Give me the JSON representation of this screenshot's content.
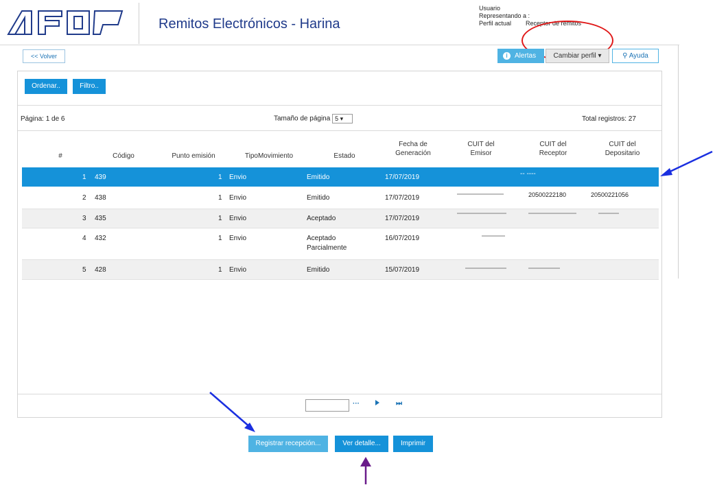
{
  "header": {
    "app_title": "Remitos Electrónicos - Harina",
    "usuario_label": "Usuario",
    "representando_label": "Representando a :",
    "perfil_label": "Perfil actual",
    "perfil_value": "Receptor de remitos"
  },
  "toolbar": {
    "volver": "<< Volver",
    "alertas": "Alertas",
    "cambiar_perfil": "Cambiar perfil ▾",
    "ayuda": "Ayuda"
  },
  "actions": {
    "ordenar": "Ordenar..",
    "filtro": "Filtro.."
  },
  "paging": {
    "pagina": "Página: 1 de 6",
    "tamanio_label": "Tamaño de página",
    "tamanio_value": "5 ▾",
    "total": "Total registros: 27"
  },
  "table": {
    "columns": [
      "#",
      "Código",
      "Punto emisión",
      "TipoMovimiento",
      "Estado",
      "Fecha de Generación",
      "CUIT del Emisor",
      "CUIT del Receptor",
      "CUIT del Depositario"
    ],
    "rows": [
      {
        "n": "1",
        "codigo": "439",
        "punto": "1",
        "tipo": "Envio",
        "estado": "Emitido",
        "fecha": "17/07/2019",
        "emisor": "",
        "receptor": "-- ----",
        "depositario": ""
      },
      {
        "n": "2",
        "codigo": "438",
        "punto": "1",
        "tipo": "Envio",
        "estado": "Emitido",
        "fecha": "17/07/2019",
        "emisor": "",
        "receptor": "20500222180",
        "depositario": "20500221056"
      },
      {
        "n": "3",
        "codigo": "435",
        "punto": "1",
        "tipo": "Envio",
        "estado": "Aceptado",
        "fecha": "17/07/2019",
        "emisor": "",
        "receptor": "",
        "depositario": ""
      },
      {
        "n": "4",
        "codigo": "432",
        "punto": "1",
        "tipo": "Envio",
        "estado": "Aceptado Parcialmente",
        "fecha": "16/07/2019",
        "emisor": "",
        "receptor": "",
        "depositario": ""
      },
      {
        "n": "5",
        "codigo": "428",
        "punto": "1",
        "tipo": "Envio",
        "estado": "Emitido",
        "fecha": "15/07/2019",
        "emisor": "",
        "receptor": "",
        "depositario": ""
      }
    ]
  },
  "pager": {
    "dots": "···",
    "last": "⏭"
  },
  "bottom": {
    "registrar": "Registrar recepción...",
    "ver_detalle": "Ver detalle...",
    "imprimir": "Imprimir"
  },
  "colors": {
    "accent": "#1592d9",
    "title": "#1f3a8a",
    "annotation_red": "#e01818",
    "annotation_blue": "#1a2fe0",
    "annotation_purple": "#6a1b8a"
  }
}
